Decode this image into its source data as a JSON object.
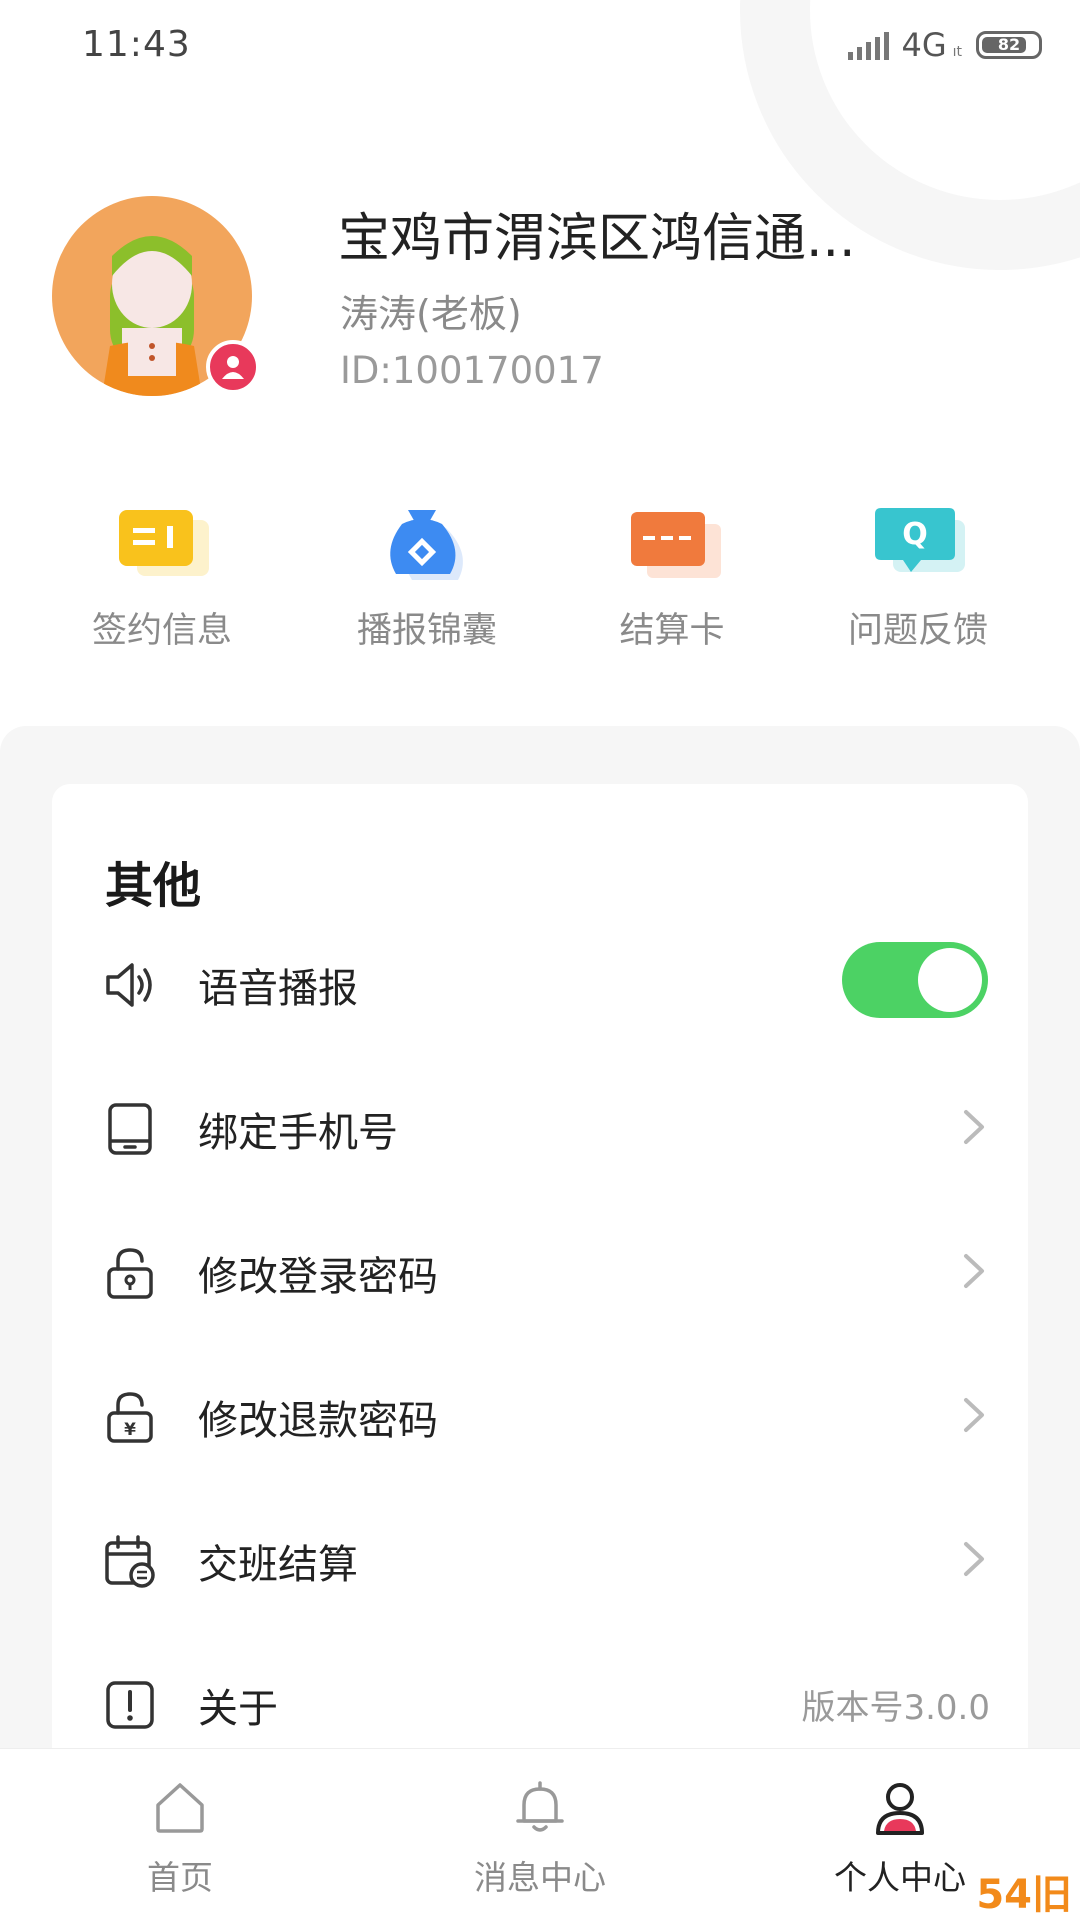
{
  "status_bar": {
    "time": "11:43",
    "network": "4G",
    "network_sub": "ıt",
    "battery": "82",
    "battery_level": 0.82
  },
  "profile": {
    "store_name": "宝鸡市渭滨区鸿信通...",
    "user_name": "涛涛(老板)",
    "user_id": "ID:100170017",
    "avatar_icon": "girl-avatar-icon",
    "badge_icon": "user-badge-icon"
  },
  "quick_actions": [
    {
      "label": "签约信息",
      "icon": "contract-card-icon",
      "color": "#f9c21c"
    },
    {
      "label": "播报锦囊",
      "icon": "money-bag-icon",
      "color": "#3d8bf2"
    },
    {
      "label": "结算卡",
      "icon": "bank-card-icon",
      "color": "#f07a3d"
    },
    {
      "label": "问题反馈",
      "icon": "feedback-bubble-icon",
      "color": "#38c5cf"
    }
  ],
  "other_section": {
    "title": "其他",
    "items": [
      {
        "label": "语音播报",
        "icon": "speaker-icon",
        "control": "toggle",
        "toggle_on": true
      },
      {
        "label": "绑定手机号",
        "icon": "phone-icon",
        "control": "chevron"
      },
      {
        "label": "修改登录密码",
        "icon": "lock-icon",
        "control": "chevron"
      },
      {
        "label": "修改退款密码",
        "icon": "yuan-lock-icon",
        "control": "chevron"
      },
      {
        "label": "交班结算",
        "icon": "calendar-exchange-icon",
        "control": "chevron"
      },
      {
        "label": "关于",
        "icon": "info-icon",
        "control": "value",
        "value": "版本号3.0.0"
      }
    ]
  },
  "bottom_nav": [
    {
      "label": "首页",
      "icon": "home-icon",
      "active": false
    },
    {
      "label": "消息中心",
      "icon": "bell-icon",
      "active": false
    },
    {
      "label": "个人中心",
      "icon": "person-icon",
      "active": true
    }
  ],
  "watermark": "54旧",
  "colors": {
    "toggle_on": "#4cd264",
    "badge": "#e8395b",
    "avatar_bg": "#f2a55c"
  }
}
